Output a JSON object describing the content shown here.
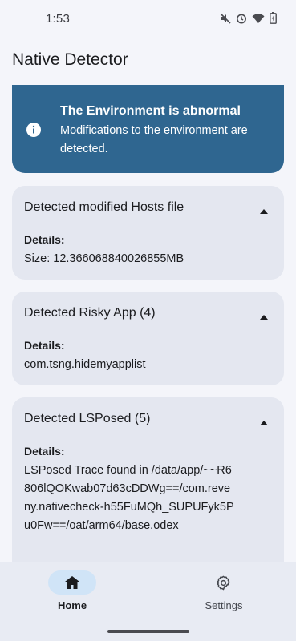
{
  "status_bar": {
    "time": "1:53",
    "icons": [
      "mute-icon",
      "alarm-icon",
      "wifi-icon",
      "battery-icon"
    ]
  },
  "app": {
    "title": "Native Detector"
  },
  "banner": {
    "icon": "info-icon",
    "title": "The Environment is abnormal",
    "description": "Modifications to the environment are detected.",
    "color": "#2f6690"
  },
  "cards": [
    {
      "title": "Detected modified Hosts file",
      "details_label": "Details:",
      "details": "Size: 12.366068840026855MB"
    },
    {
      "title": "Detected Risky App (4)",
      "details_label": "Details:",
      "details": "com.tsng.hidemyapplist"
    },
    {
      "title": "Detected LSPosed (5)",
      "details_label": "Details:",
      "details": "LSPosed Trace found in /data/app/~~R6806lQOKwab07d63cDDWg==/com.reveny.nativecheck-h55FuMQh_SUPUFyk5Pu0Fw==/oat/arm64/base.odex"
    }
  ],
  "bottom_nav": {
    "items": [
      {
        "label": "Home",
        "icon": "home-icon",
        "active": true
      },
      {
        "label": "Settings",
        "icon": "gear-icon",
        "active": false
      }
    ]
  }
}
